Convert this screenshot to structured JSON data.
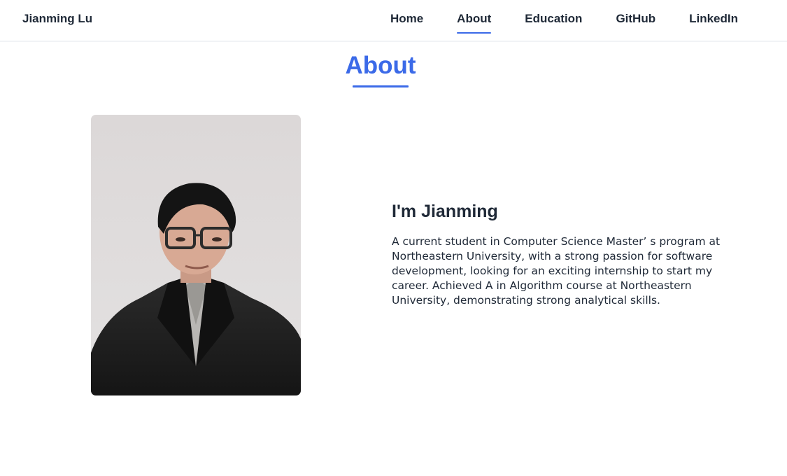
{
  "header": {
    "brand": "Jianming Lu",
    "nav": [
      {
        "label": "Home"
      },
      {
        "label": "About"
      },
      {
        "label": "Education"
      },
      {
        "label": "GitHub"
      },
      {
        "label": "LinkedIn"
      }
    ],
    "active": "About"
  },
  "about": {
    "title": "About",
    "heading": "I'm Jianming",
    "description": "A current student in Computer Science Master’ s program at Northeastern University, with a strong passion for software development, looking for an exciting internship to start my career. Achieved A in Algorithm course at Northeastern University, demonstrating strong analytical skills."
  },
  "colors": {
    "accent": "#3b6ae8",
    "text": "#1f2937"
  }
}
